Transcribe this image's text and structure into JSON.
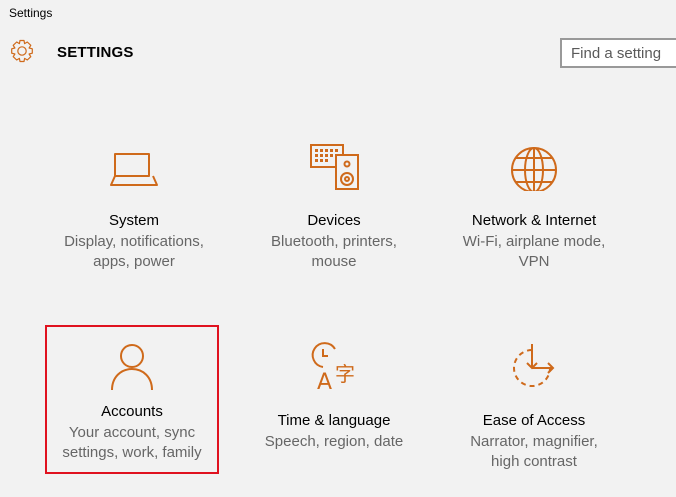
{
  "window": {
    "title": "Settings"
  },
  "header": {
    "title": "SETTINGS",
    "search_placeholder": "Find a setting"
  },
  "accent_color": "#cf6a1b",
  "selection_color": "#e0121f",
  "tiles": [
    {
      "name": "System",
      "icon": "laptop-icon",
      "desc_lines": [
        "Display, notifications,",
        "apps, power"
      ]
    },
    {
      "name": "Devices",
      "icon": "keyboard-speaker-icon",
      "desc_lines": [
        "Bluetooth, printers,",
        "mouse"
      ]
    },
    {
      "name": "Network & Internet",
      "icon": "globe-icon",
      "desc_lines": [
        "Wi-Fi, airplane mode,",
        "VPN"
      ]
    },
    {
      "name": "Accounts",
      "icon": "person-icon",
      "desc_lines": [
        "Your account, sync",
        "settings, work, family"
      ],
      "selected": true
    },
    {
      "name": "Time & language",
      "icon": "clock-language-icon",
      "desc_lines": [
        "Speech, region, date"
      ]
    },
    {
      "name": "Ease of Access",
      "icon": "ease-of-access-icon",
      "desc_lines": [
        "Narrator, magnifier,",
        "high contrast"
      ]
    }
  ]
}
